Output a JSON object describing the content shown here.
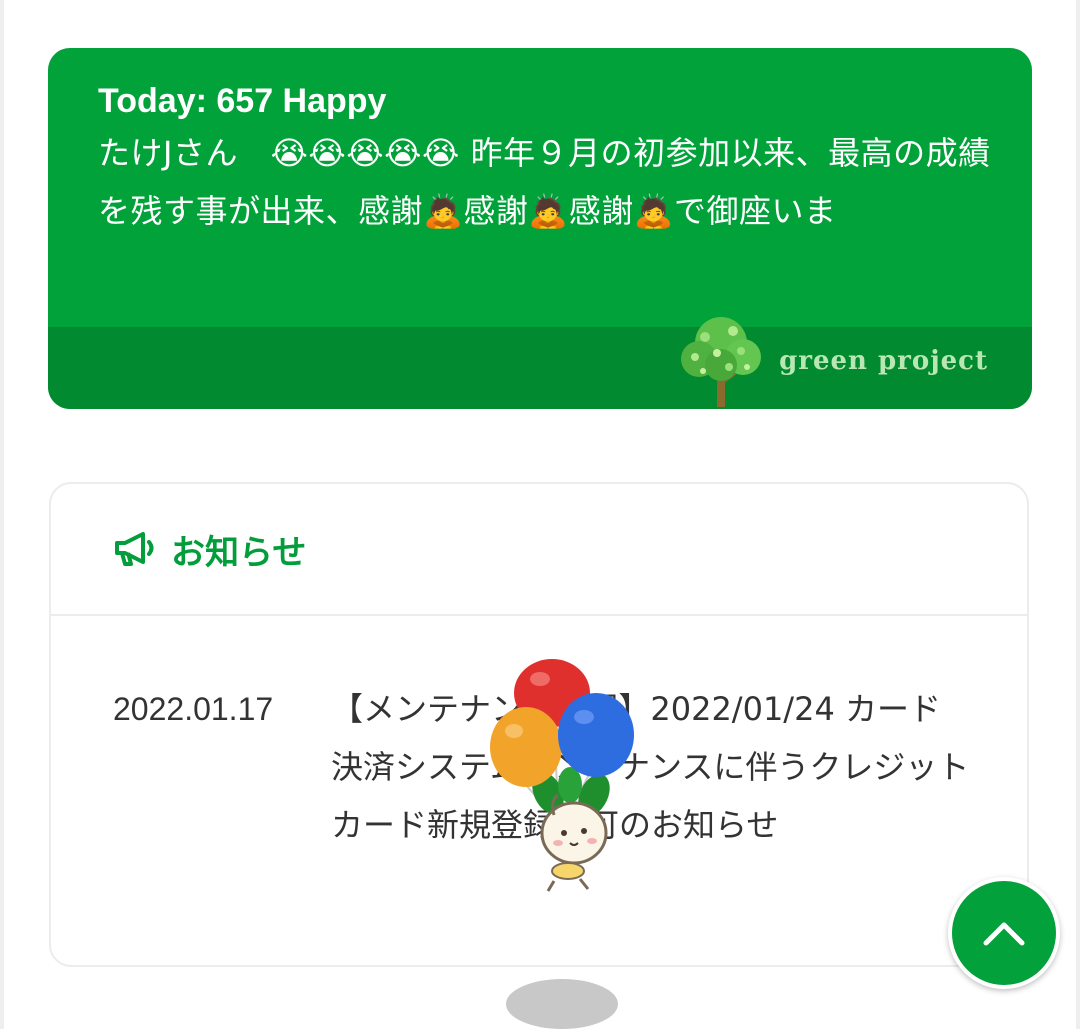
{
  "happy_card": {
    "title": "Today: 657 Happy",
    "message": "たけJさん　😭😭😭😭😭 昨年９月の初参加以来、最高の成績を残す事が出来、感謝🙇感謝🙇感謝🙇で御座いま",
    "logo_text": "green project"
  },
  "notice": {
    "header_icon": "megaphone-icon",
    "header_label": "お知らせ",
    "items": [
      {
        "date": "2022.01.17",
        "title": "【メンテナンス情報】2022/01/24 カード決済システムメンテナンスに伴うクレジットカード新規登録不可のお知らせ"
      }
    ]
  },
  "scroll_top_icon": "chevron-up-icon",
  "colors": {
    "brand_green": "#01a23a",
    "brand_green_dark": "#018a30",
    "text_dark": "#333333",
    "border": "#ececec"
  }
}
